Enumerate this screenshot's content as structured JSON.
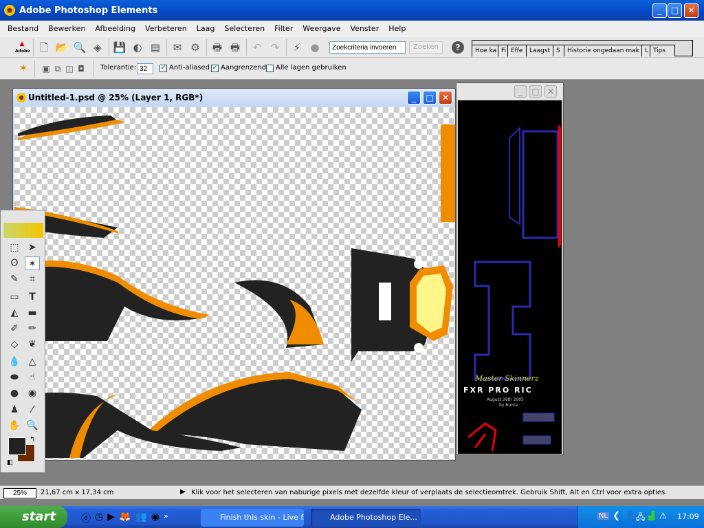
{
  "app": {
    "title": "Adobe Photoshop Elements"
  },
  "menu": [
    "Bestand",
    "Bewerken",
    "Afbeelding",
    "Verbeteren",
    "Laag",
    "Selecteren",
    "Filter",
    "Weergave",
    "Venster",
    "Help"
  ],
  "toolbar": {
    "search_placeholder": "Zoekcriteria invoeren",
    "search_button": "Zoeken",
    "help": "?",
    "adobe_logo": "Adobe"
  },
  "palette_tabs": [
    "Hoe ka",
    "Fi",
    "Effe",
    "Laagst",
    "S",
    "Historie ongedaan mak",
    "L",
    "Tips"
  ],
  "options": {
    "tolerance_label": "Tolerantie:",
    "tolerance_value": "32",
    "anti_aliased": {
      "label": "Anti-aliased",
      "checked": true
    },
    "contiguous": {
      "label": "Aangrenzend",
      "checked": true
    },
    "all_layers": {
      "label": "Alle lagen gebruiken",
      "checked": false
    }
  },
  "document1": {
    "title": "Untitled-1.psd @ 25% (Layer 1, RGB*)"
  },
  "document2": {
    "texts": {
      "brand": "Master Skinnerz",
      "model": "FXR PRO RIC",
      "date": "August 26th   2005",
      "author": "by Bunta"
    }
  },
  "colors": {
    "foreground": "#222222",
    "background": "#6b2a00",
    "accent_orange": "#f08c00",
    "pale_yellow": "#fff68a"
  },
  "statusbar": {
    "zoom": "25%",
    "size": "21,67 cm x 17,34 cm",
    "hint": "Klik voor het selecteren van naburige pixels met dezelfde kleur of verplaats de selectieomtrek.  Gebruik Shift, Alt en Ctrl voor extra opties."
  },
  "taskbar": {
    "start": "start",
    "tasks": [
      "Finish this skin - Live f...",
      "Adobe Photoshop Ele..."
    ],
    "language": "NL",
    "clock": "17:09",
    "more": "»"
  }
}
